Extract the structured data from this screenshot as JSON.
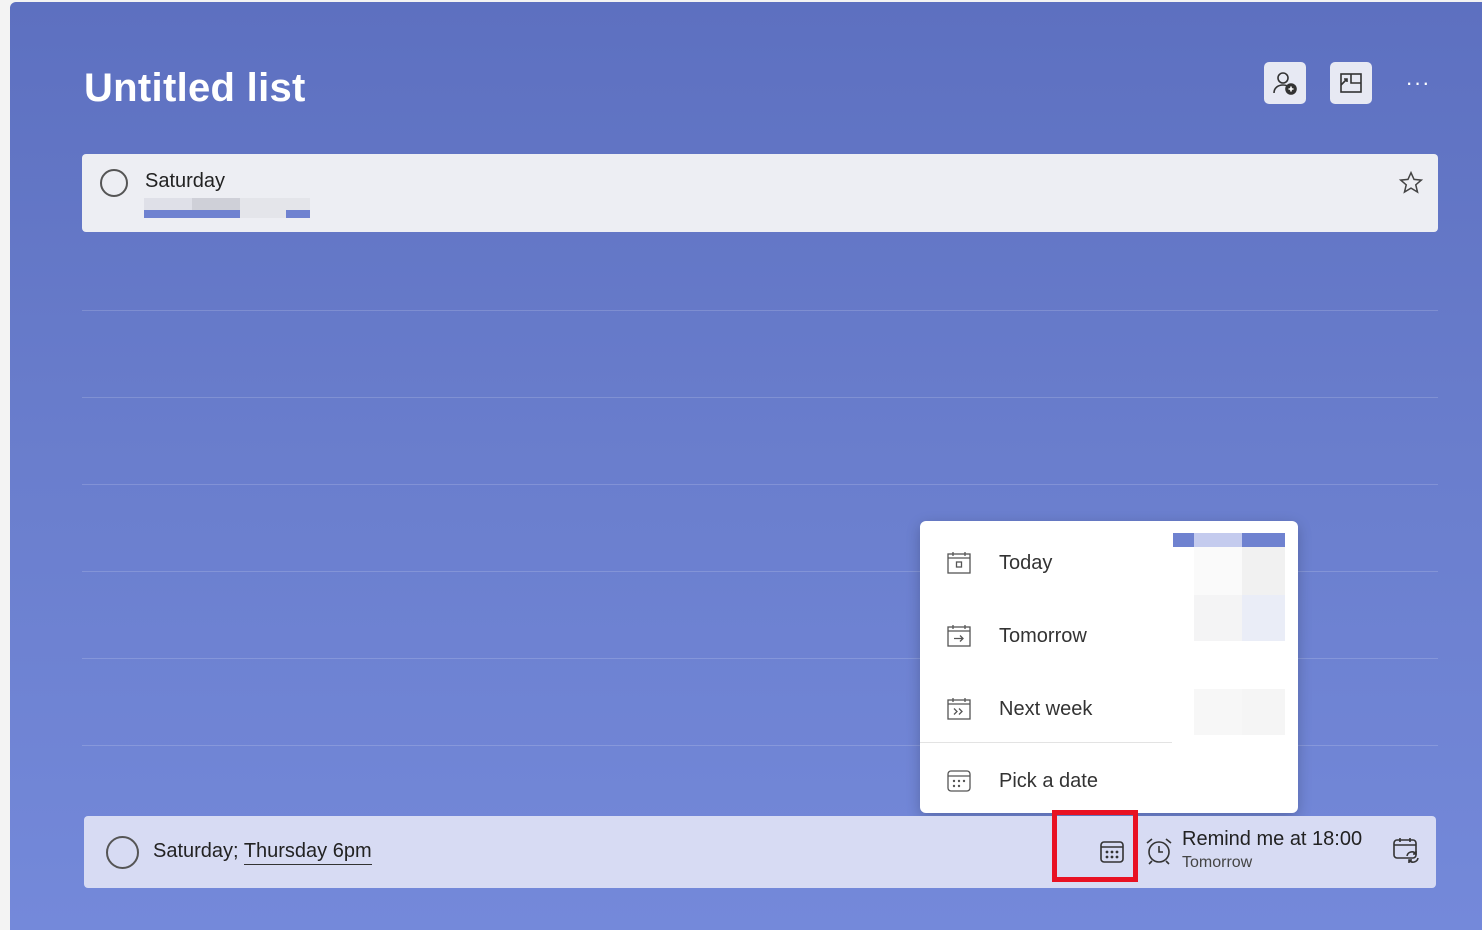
{
  "list": {
    "title": "Untitled list"
  },
  "header": {
    "share_icon": "person-add-icon",
    "background_icon": "picture-icon",
    "more_label": "···"
  },
  "tasks": [
    {
      "title": "Saturday",
      "starred": false
    }
  ],
  "add_task": {
    "text_plain": "Saturday; ",
    "text_highlight": "Thursday 6pm",
    "due_icon": "calendar-icon",
    "reminder": {
      "main": "Remind me at 18:00",
      "sub": "Tomorrow"
    },
    "repeat_icon": "repeat-icon"
  },
  "due_menu": {
    "items": [
      {
        "label": "Today",
        "icon": "calendar-today-icon"
      },
      {
        "label": "Tomorrow",
        "icon": "calendar-tomorrow-icon"
      },
      {
        "label": "Next week",
        "icon": "calendar-next-week-icon"
      },
      {
        "label": "Pick a date",
        "icon": "calendar-pick-icon"
      }
    ]
  },
  "colors": {
    "background_top": "#5d70c0",
    "background_bottom": "#7489da",
    "card": "#edeef3",
    "add_bar": "#d7dbf3",
    "highlight": "#e81123"
  }
}
